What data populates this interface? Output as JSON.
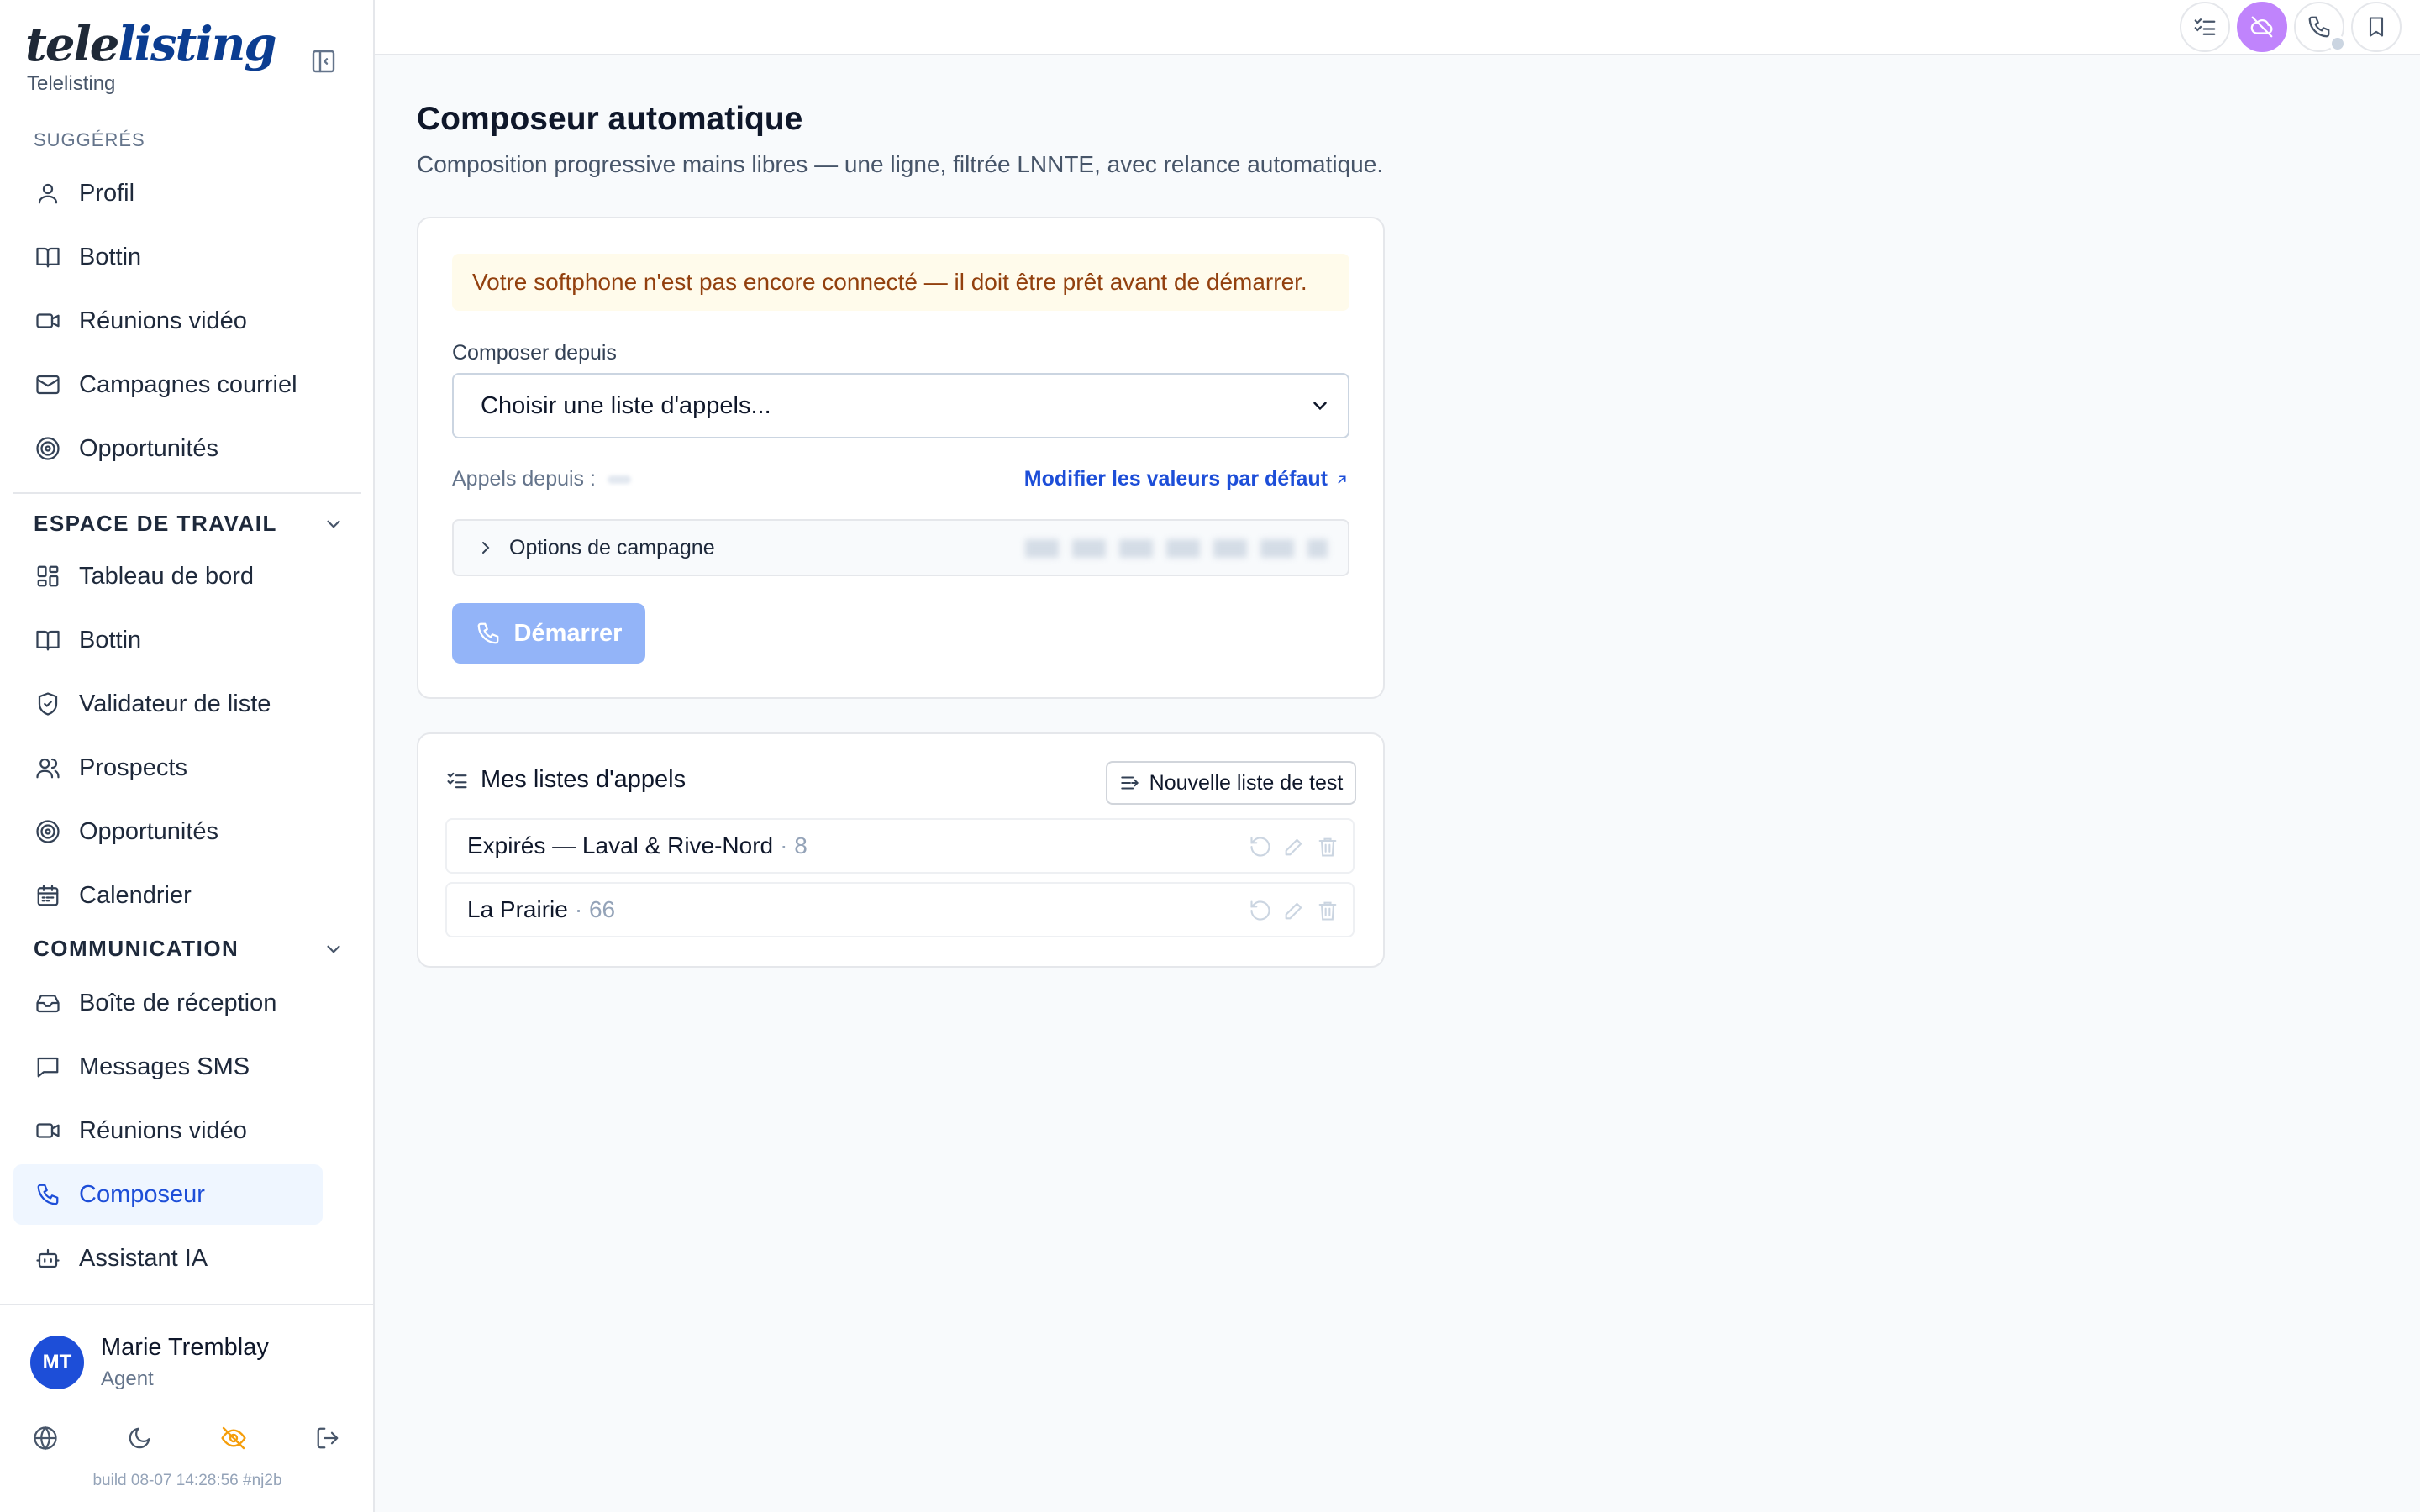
{
  "brand": {
    "logo_part1": "tele",
    "logo_part2": "listing",
    "name": "Telelisting"
  },
  "sidebar": {
    "suggested_label": "SUGGÉRÉS",
    "suggested": [
      {
        "label": "Profil",
        "icon": "user-icon"
      },
      {
        "label": "Bottin",
        "icon": "book-icon"
      },
      {
        "label": "Réunions vidéo",
        "icon": "video-icon"
      },
      {
        "label": "Campagnes courriel",
        "icon": "mail-icon"
      },
      {
        "label": "Opportunités",
        "icon": "target-icon"
      }
    ],
    "workspace_label": "ESPACE DE TRAVAIL",
    "workspace": [
      {
        "label": "Tableau de bord",
        "icon": "dashboard-icon"
      },
      {
        "label": "Bottin",
        "icon": "book-icon"
      },
      {
        "label": "Validateur de liste",
        "icon": "shield-check-icon"
      },
      {
        "label": "Prospects",
        "icon": "users-icon"
      },
      {
        "label": "Opportunités",
        "icon": "target-icon"
      },
      {
        "label": "Calendrier",
        "icon": "calendar-icon"
      }
    ],
    "communication_label": "COMMUNICATION",
    "communication": [
      {
        "label": "Boîte de réception",
        "icon": "inbox-icon"
      },
      {
        "label": "Messages SMS",
        "icon": "message-icon"
      },
      {
        "label": "Réunions vidéo",
        "icon": "video-icon"
      },
      {
        "label": "Composeur",
        "icon": "phone-icon",
        "active": true
      },
      {
        "label": "Assistant IA",
        "icon": "bot-icon"
      }
    ],
    "user": {
      "initials": "MT",
      "name": "Marie Tremblay",
      "role": "Agent"
    },
    "build": "build 08-07 14:28:56 #nj2b"
  },
  "topbar": {
    "icons": [
      "checklist-icon",
      "cloud-off-icon",
      "phone-icon",
      "bookmark-icon"
    ],
    "accent": "#c084fc"
  },
  "main": {
    "title": "Composeur automatique",
    "subtitle": "Composition progressive mains libres — une ligne, filtrée LNNTE, avec relance automatique.",
    "warning": "Votre softphone n'est pas encore connecté — il doit être prêt avant de démarrer.",
    "compose_from_label": "Composer depuis",
    "select_value": "Choisir une liste d'appels...",
    "calls_from_label": "Appels depuis :",
    "modify_defaults": "Modifier les valeurs par défaut",
    "campaign_options": "Options de campagne",
    "start_label": "Démarrer",
    "lists_title": "Mes listes d'appels",
    "new_list_label": "Nouvelle liste de test",
    "lists": [
      {
        "name": "Expirés — Laval & Rive-Nord",
        "count": "· 8"
      },
      {
        "name": "La Prairie",
        "count": "· 66"
      }
    ]
  },
  "colors": {
    "primary": "#1d4ed8",
    "warning_bg": "#fffbeb",
    "warning_text": "#92400e",
    "start_disabled": "#93b4f8"
  }
}
